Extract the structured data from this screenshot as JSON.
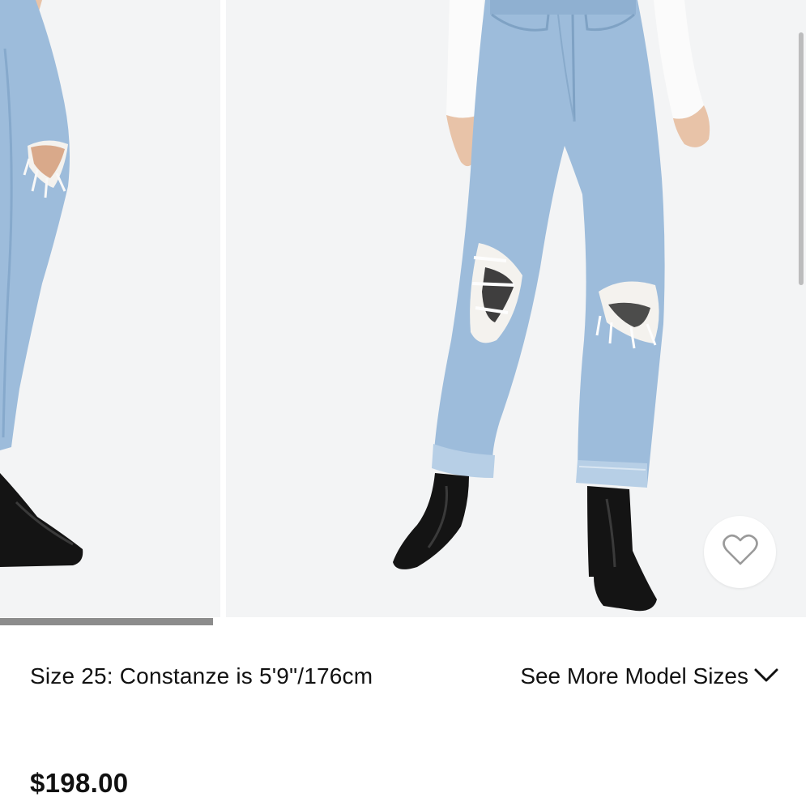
{
  "gallery": {
    "images": [
      {
        "alt": "model-left-crop"
      },
      {
        "alt": "model-front-view"
      }
    ],
    "favorite_icon": "heart-outline-icon"
  },
  "model_info": {
    "size_text": "Size 25: Constanze is 5'9\"/176cm",
    "see_more_label": "See More Model Sizes",
    "see_more_icon": "chevron-down-icon"
  },
  "product": {
    "price": "$198.00"
  },
  "colors": {
    "denim": "#9dbcdb",
    "denim_dark": "#7fa2c4",
    "boot": "#141414",
    "background": "#f3f4f5"
  }
}
